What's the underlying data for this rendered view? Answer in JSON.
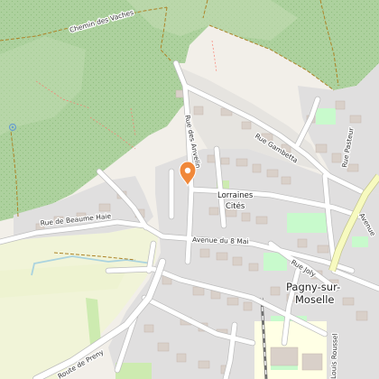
{
  "map": {
    "town": {
      "line1": "Pagny-sur-",
      "line2": "Moselle"
    },
    "place": {
      "line1": "Lorraines",
      "line2": "Cités"
    },
    "roads": {
      "chemin_vaches": "Chemin des Vaches",
      "rue_anvelin": "Rue des Anvelin",
      "rue_gambetta": "Rue Gambetta",
      "rue_pasteur": "Rue Pasteur",
      "rue_beaume_haie": "Rue de Beaume Haie",
      "avenue_8_mai": "Avenue du 8 Mai",
      "rue_joly": "Rue Joly",
      "avenue_edge": "Avenue",
      "route_preny": "Route de Preny",
      "rue_roussel": "Louis Roussel"
    },
    "marker": {
      "icon": "location-pin-icon",
      "color": "#f0883a"
    },
    "colors": {
      "forest": "#add19e",
      "meadow": "#f1f4d8",
      "residential": "#e0dfdf",
      "park": "#c8facc",
      "building": "#d9d0c9",
      "water": "#aad3df",
      "road": "#ffffff",
      "major_road": "#f7fabf"
    }
  }
}
